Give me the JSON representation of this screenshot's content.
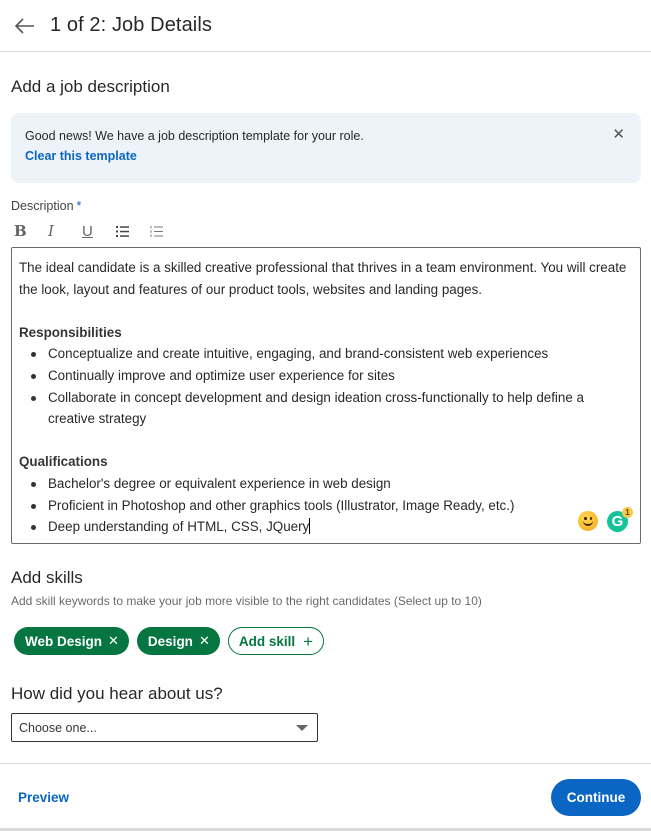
{
  "header": {
    "back_icon": "arrow-left-icon",
    "title": "1 of 2: Job Details"
  },
  "description_section": {
    "title": "Add a job description",
    "notice": {
      "text": "Good news! We have a job description template for your role.",
      "link_label": "Clear this template",
      "close_icon": "close-icon",
      "close_glyph": "✕"
    },
    "field_label": "Description",
    "required_mark": "*",
    "toolbar": [
      {
        "name": "bold",
        "glyph": "B"
      },
      {
        "name": "italic",
        "glyph": "I"
      },
      {
        "name": "underline",
        "glyph": "U"
      },
      {
        "name": "bulleted-list",
        "glyph": "☰"
      },
      {
        "name": "numbered-list",
        "glyph": "≡"
      }
    ],
    "editor": {
      "intro": "The ideal candidate is a skilled creative professional that thrives in a team environment. You will create the look, layout and features of our product tools, websites and landing pages.",
      "responsibilities_heading": "Responsibilities",
      "responsibilities": [
        "Conceptualize and create intuitive, engaging, and brand-consistent web experiences",
        "Continually improve and optimize user experience for sites",
        "Collaborate in concept development and design ideation cross-functionally to help define a creative strategy"
      ],
      "qualifications_heading": "Qualifications",
      "qualifications": [
        "Bachelor's degree or equivalent experience in web design",
        "Proficient in Photoshop and other graphics tools (Illustrator, Image Ready, etc.)",
        "Deep understanding of HTML, CSS, JQuery"
      ],
      "grammarly_letter": "G",
      "grammarly_count": "1"
    }
  },
  "skills_section": {
    "title": "Add skills",
    "help_text": "Add skill keywords to make your job more visible to the right candidates (Select up to 10)",
    "skills": [
      {
        "label": "Web Design",
        "remove_glyph": "✕"
      },
      {
        "label": "Design",
        "remove_glyph": "✕"
      }
    ],
    "add_skill_label": "Add skill",
    "add_skill_glyph": "+"
  },
  "source_section": {
    "title": "How did you hear about us?",
    "select_value": "Choose one..."
  },
  "footer": {
    "preview_label": "Preview",
    "continue_label": "Continue"
  },
  "colors": {
    "primary_blue": "#0a66c2",
    "skill_green": "#057642",
    "notice_bg": "#edf3f8",
    "grammarly_green": "#15c39a"
  }
}
